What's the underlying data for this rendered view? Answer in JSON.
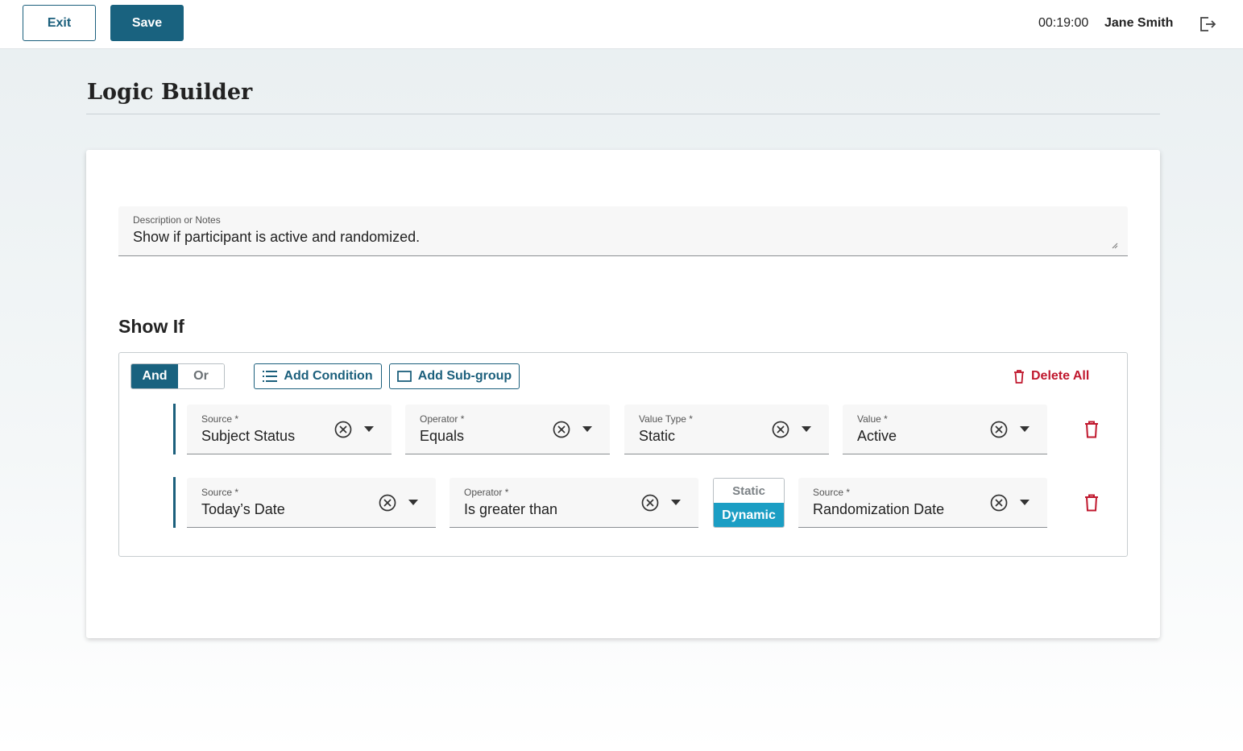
{
  "header": {
    "exit_label": "Exit",
    "save_label": "Save",
    "timer": "00:19:00",
    "user_name": "Jane Smith",
    "logout_icon": "logout-icon"
  },
  "page": {
    "title": "Logic Builder"
  },
  "notes": {
    "label": "Description or Notes",
    "value": "Show if participant is active and randomized."
  },
  "show_if": {
    "title": "Show If",
    "toggle": {
      "and": "And",
      "or": "Or",
      "selected": "And"
    },
    "add_condition_label": "Add Condition",
    "add_subgroup_label": "Add Sub-group",
    "delete_all_label": "Delete All",
    "rows": [
      {
        "fields": [
          {
            "label": "Source",
            "value": "Subject Status"
          },
          {
            "label": "Operator",
            "value": "Equals"
          },
          {
            "label": "Value Type",
            "value": "Static"
          },
          {
            "label": "Value",
            "value": "Active"
          }
        ]
      },
      {
        "fields": [
          {
            "label": "Source",
            "value": "Today’s Date"
          },
          {
            "label": "Operator",
            "value": "Is greater than"
          },
          {
            "label": "Source",
            "value": "Randomization Date"
          }
        ],
        "value_type_toggle": {
          "static": "Static",
          "dynamic": "Dynamic",
          "selected": "Dynamic"
        }
      }
    ]
  },
  "colors": {
    "primary": "#19627f",
    "accent": "#1b9ec4",
    "danger": "#c0182e"
  }
}
